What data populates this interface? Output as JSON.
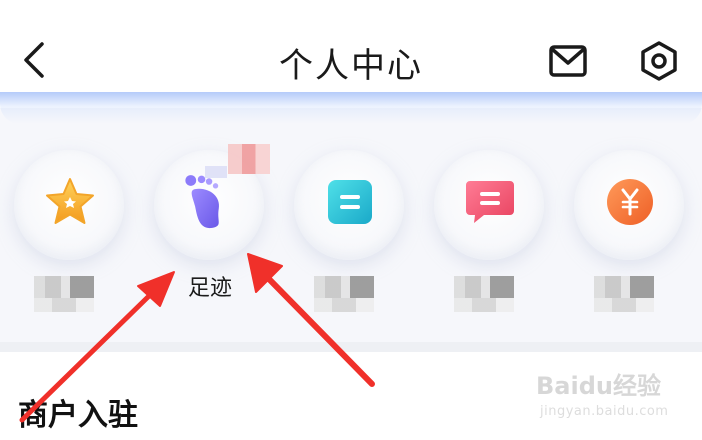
{
  "header": {
    "title": "个人中心",
    "icons": [
      "back-icon",
      "mail-icon",
      "gear-icon"
    ]
  },
  "quick_items": [
    {
      "icon": "star-icon",
      "label": "",
      "label_hidden": true,
      "color": "#F6A623"
    },
    {
      "icon": "footprint-icon",
      "label": "足迹",
      "label_hidden": false,
      "color": "#7C6CF0"
    },
    {
      "icon": "list-icon",
      "label": "",
      "label_hidden": true,
      "color": "#2EC7D3"
    },
    {
      "icon": "message-icon",
      "label": "",
      "label_hidden": true,
      "color": "#F25C7A"
    },
    {
      "icon": "yen-icon",
      "label": "",
      "label_hidden": true,
      "color": "#F27A3A"
    }
  ],
  "section": {
    "title": "商户入驻"
  },
  "watermark": {
    "brand": "Baidu经验",
    "url": "jingyan.baidu.com"
  },
  "colors": {
    "accent_blue": "#8FB4F7",
    "annotation_arrow": "#F0302A"
  }
}
